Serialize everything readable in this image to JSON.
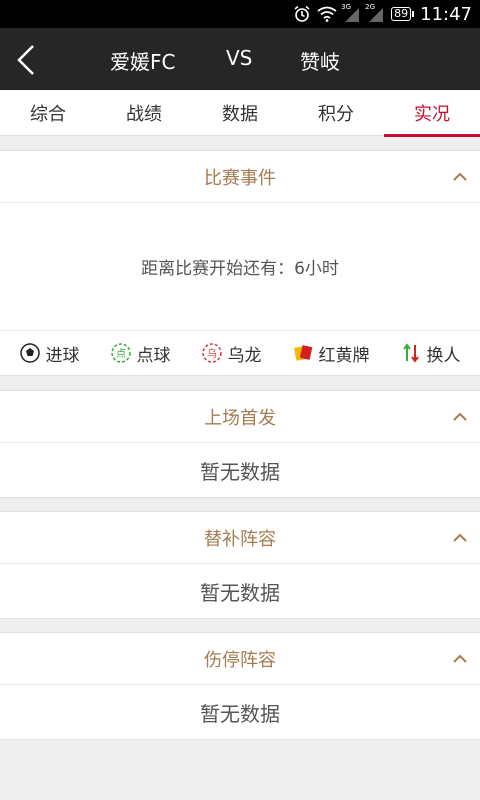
{
  "status_bar": {
    "time": "11:47",
    "battery": "89",
    "sig1_tag": "3G",
    "sig2_tag": "2G"
  },
  "header": {
    "home_team": "爱媛FC",
    "vs": "VS",
    "away_team": "赞岐"
  },
  "tabs": [
    {
      "label": "综合"
    },
    {
      "label": "战绩"
    },
    {
      "label": "数据"
    },
    {
      "label": "积分"
    },
    {
      "label": "实况",
      "active": true
    }
  ],
  "match_events": {
    "title": "比赛事件",
    "countdown": "距离比赛开始还有：6小时",
    "legend": [
      {
        "label": "进球",
        "icon": "soccer-ball-icon"
      },
      {
        "label": "点球",
        "icon": "penalty-icon"
      },
      {
        "label": "乌龙",
        "icon": "own-goal-icon"
      },
      {
        "label": "红黄牌",
        "icon": "red-yellow-card-icon"
      },
      {
        "label": "换人",
        "icon": "substitution-icon"
      }
    ]
  },
  "lineup": {
    "title": "上场首发",
    "empty": "暂无数据"
  },
  "subs": {
    "title": "替补阵容",
    "empty": "暂无数据"
  },
  "injuries": {
    "title": "伤停阵容",
    "empty": "暂无数据"
  },
  "colors": {
    "accent": "#c8102e",
    "section_title": "#a67c52",
    "navbar": "#262626"
  }
}
